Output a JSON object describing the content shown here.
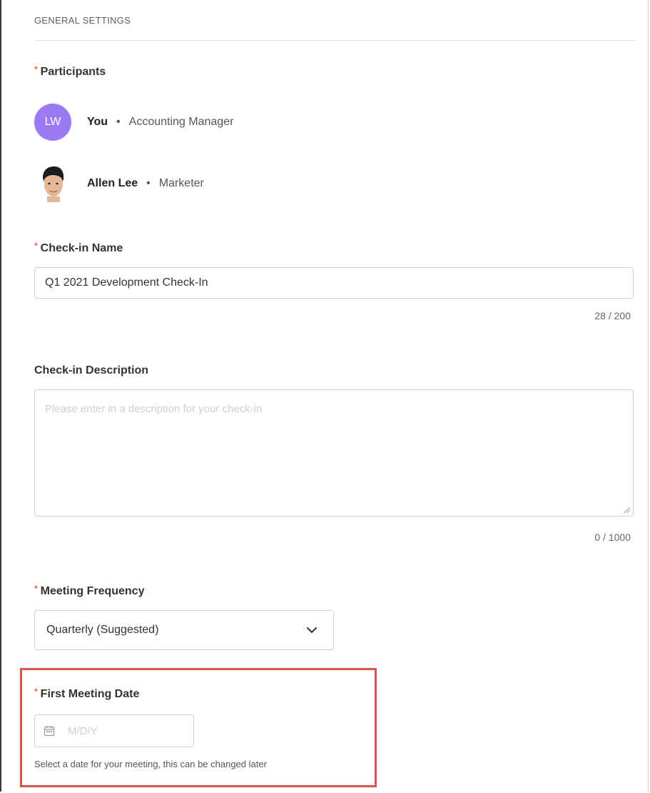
{
  "section": {
    "title": "GENERAL SETTINGS"
  },
  "participants": {
    "label": "Participants",
    "required_mark": "*",
    "items": [
      {
        "initials": "LW",
        "name": "You",
        "separator": "•",
        "role": "Accounting Manager",
        "avatar_color": "#9b7bf2"
      },
      {
        "avatar": "person-photo-icon",
        "name": "Allen Lee",
        "separator": "•",
        "role": "Marketer"
      }
    ]
  },
  "checkin_name": {
    "label": "Check-in Name",
    "required_mark": "*",
    "value": "Q1 2021 Development Check-In",
    "counter": "28 / 200"
  },
  "checkin_description": {
    "label": "Check-in Description",
    "placeholder": "Please enter in a description for your check-in",
    "value": "",
    "counter": "0 / 1000"
  },
  "meeting_frequency": {
    "label": "Meeting Frequency",
    "required_mark": "*",
    "selected": "Quarterly (Suggested)",
    "icon": "chevron-down-icon"
  },
  "first_meeting_date": {
    "label": "First Meeting Date",
    "required_mark": "*",
    "placeholder": "M/D/Y",
    "icon": "calendar-icon",
    "helper": "Select a date for your meeting, this can be changed later"
  },
  "colors": {
    "accent_required": "#e0673a",
    "highlight_border": "#d9534f",
    "avatar_purple": "#9b7bf2"
  }
}
